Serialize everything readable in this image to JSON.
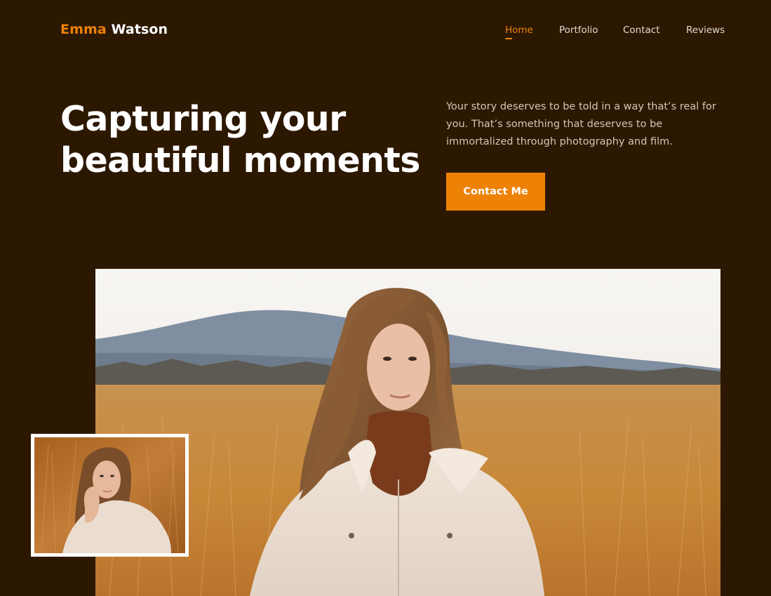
{
  "brand": {
    "first_name": "Emma",
    "last_name": "Watson",
    "accent_color": "#ee8207",
    "background_color": "#2c1800"
  },
  "nav": {
    "items": [
      {
        "label": "Home",
        "active": true
      },
      {
        "label": "Portfolio",
        "active": false
      },
      {
        "label": "Contact",
        "active": false
      },
      {
        "label": "Reviews",
        "active": false
      }
    ]
  },
  "hero": {
    "title_line1": "Capturing your",
    "title_line2": "beautiful moments",
    "description": "Your story deserves to be told in a way that’s real for you. That’s something that deserves to be immortalized through photography and film.",
    "cta_label": "Contact Me"
  }
}
